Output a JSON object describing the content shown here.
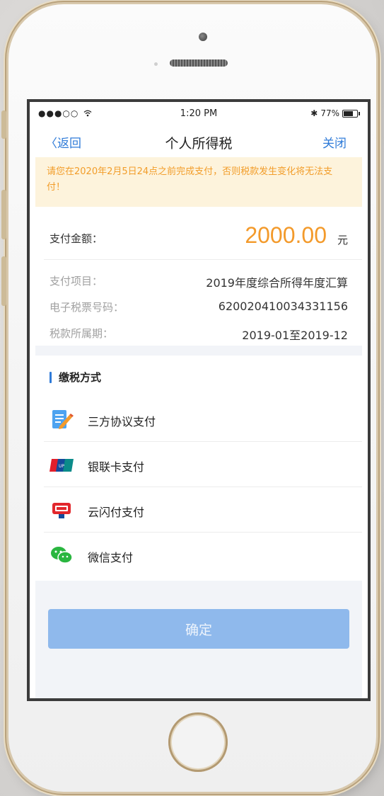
{
  "status_bar": {
    "signal": "●●●○○",
    "time": "1:20 PM",
    "bluetooth": "✱",
    "battery_percent": "77%"
  },
  "nav": {
    "back_label": "〈返回",
    "title": "个人所得税",
    "close_label": "关闭"
  },
  "notice": {
    "text": "请您在2020年2月5日24点之前完成支付，否则税款发生变化将无法支付！"
  },
  "payment": {
    "amount_label": "支付金额：",
    "amount_value": "2000.00",
    "amount_unit": "元",
    "details": [
      {
        "label": "支付项目：",
        "value": "2019年度综合所得年度汇算"
      },
      {
        "label": "电子税票号码：",
        "value": "620020410034331156"
      },
      {
        "label": "税款所属期：",
        "value": "2019-01至2019-12"
      }
    ]
  },
  "payment_methods": {
    "title": "缴税方式",
    "items": [
      {
        "label": "三方协议支付",
        "icon": "agreement-icon"
      },
      {
        "label": "银联卡支付",
        "icon": "unionpay-icon"
      },
      {
        "label": "云闪付支付",
        "icon": "quickpass-icon"
      },
      {
        "label": "微信支付",
        "icon": "wechat-icon"
      }
    ]
  },
  "confirm_label": "确定",
  "colors": {
    "accent_blue": "#2f7bd8",
    "amount_orange": "#f39a2b",
    "notice_bg": "#fdf3dc",
    "confirm_disabled": "#8fb9ec"
  }
}
